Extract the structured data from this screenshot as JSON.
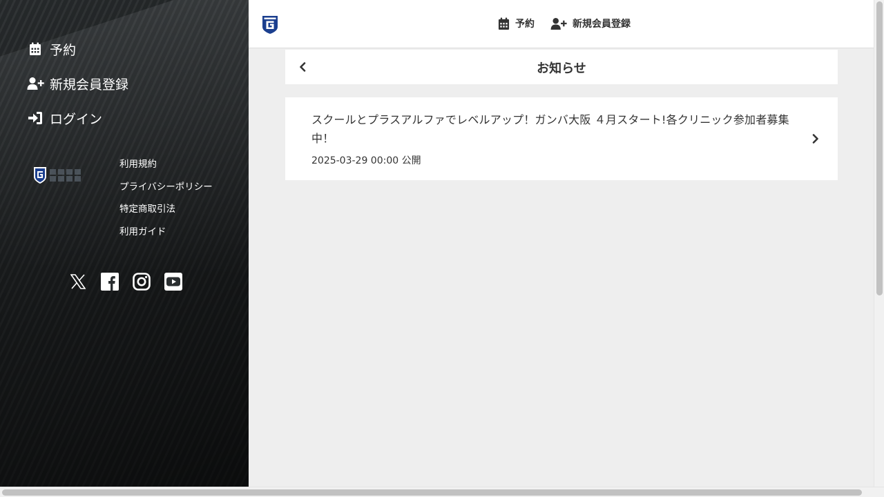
{
  "sidebar": {
    "nav": [
      {
        "label": "予約",
        "icon": "calendar-icon"
      },
      {
        "label": "新規会員登録",
        "icon": "user-plus-icon"
      },
      {
        "label": "ログイン",
        "icon": "sign-in-icon"
      }
    ],
    "footer_links": [
      "利用規約",
      "プライバシーポリシー",
      "特定商取引法",
      "利用ガイド"
    ],
    "social": [
      "x-icon",
      "facebook-icon",
      "instagram-icon",
      "youtube-icon"
    ]
  },
  "header": {
    "nav": [
      {
        "label": "予約",
        "icon": "calendar-icon"
      },
      {
        "label": "新規会員登録",
        "icon": "user-plus-icon"
      }
    ]
  },
  "page": {
    "title": "お知らせ"
  },
  "news": [
    {
      "headline": "スクールとプラスアルファでレベルアップ！ガンバ大阪 ４月スタート!各クリニック参加者募集中！",
      "meta": "2025-03-29 00:00 公開"
    }
  ],
  "colors": {
    "brand_blue": "#1b3f8f",
    "text": "#333333",
    "background": "#eeeeee"
  }
}
